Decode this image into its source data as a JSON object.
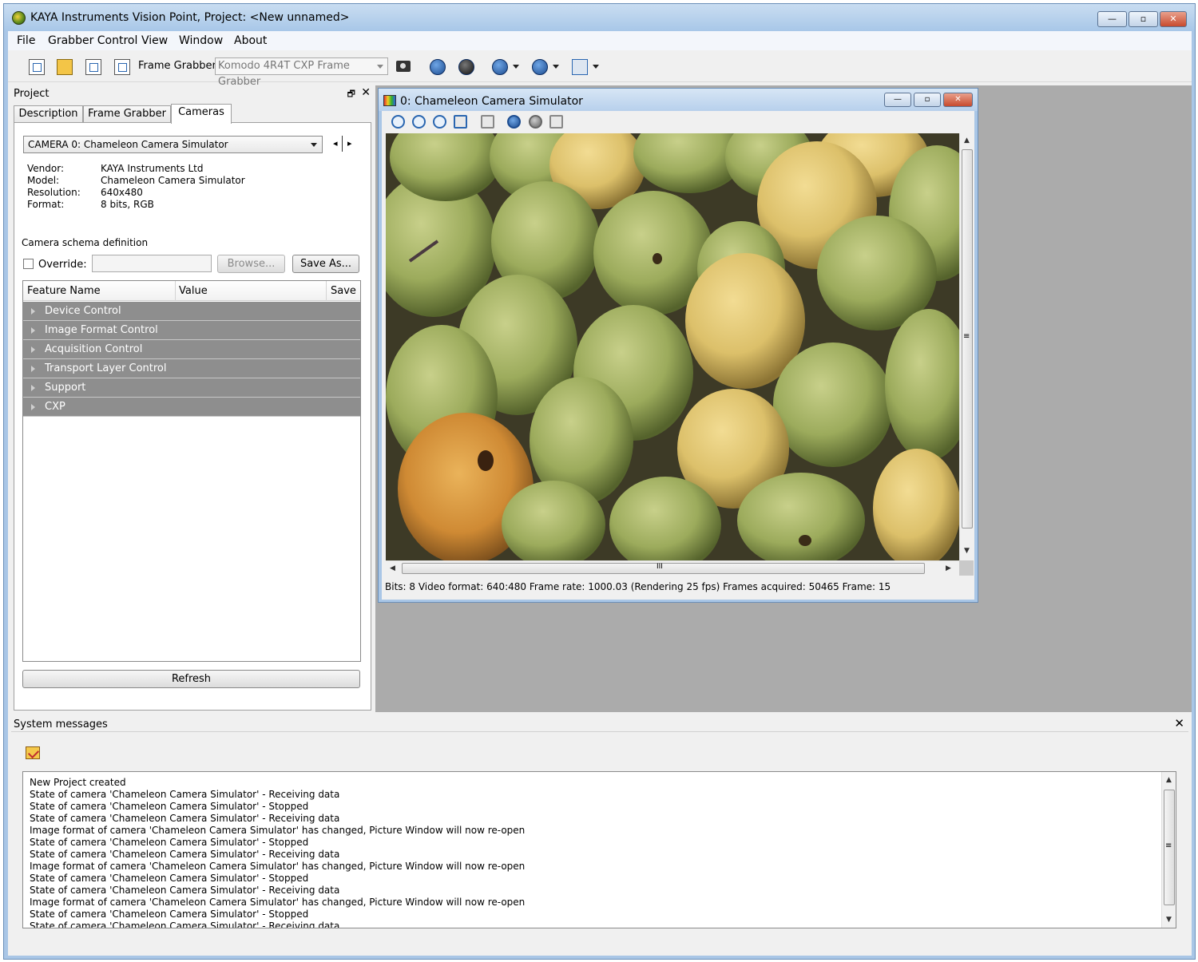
{
  "window": {
    "title": "KAYA Instruments Vision Point, Project: <New unnamed>",
    "min_label": "—",
    "max_label": "▫",
    "close_label": "✕"
  },
  "menu": [
    "File",
    "Grabber Control",
    "View",
    "Window",
    "About"
  ],
  "toolbar": {
    "frame_grabber_label": "Frame Grabber:",
    "frame_grabber_value": "Komodo 4R4T CXP Frame Grabber"
  },
  "project": {
    "title": "Project",
    "float_label": "🗗",
    "close_label": "✕",
    "tabs": [
      "Description",
      "Frame Grabber",
      "Cameras"
    ],
    "active_tab": "Cameras",
    "camera_select": "CAMERA 0: Chameleon Camera Simulator",
    "nav_prev": "◂",
    "nav_next": "▸",
    "info": [
      {
        "key": "Vendor:",
        "value": "KAYA Instruments Ltd"
      },
      {
        "key": "Model:",
        "value": "Chameleon Camera Simulator"
      },
      {
        "key": "Resolution:",
        "value": "640x480"
      },
      {
        "key": "Format:",
        "value": "8 bits, RGB"
      }
    ],
    "schema_label": "Camera schema definition",
    "override_label": "Override:",
    "override_checked": false,
    "override_value": "",
    "browse_label": "Browse...",
    "save_as_label": "Save As...",
    "feature_headers": [
      "Feature Name",
      "Value",
      "Save"
    ],
    "feature_categories": [
      "Device Control",
      "Image Format Control",
      "Acquisition Control",
      "Transport Layer Control",
      "Support",
      "CXP"
    ],
    "refresh_label": "Refresh"
  },
  "picture_window": {
    "title": "0: Chameleon Camera Simulator",
    "min_label": "—",
    "max_label": "▫",
    "close_label": "✕",
    "hscroll_grip": "III",
    "vscroll_grip": "≡",
    "status": "Bits: 8  Video format: 640:480  Frame rate: 1000.03 (Rendering 25 fps)  Frames acquired: 50465  Frame: 15"
  },
  "system_messages": {
    "title": "System messages",
    "close_label": "✕",
    "lines": [
      "New Project created",
      "State of camera 'Chameleon Camera Simulator' - Receiving data",
      "State of camera 'Chameleon Camera Simulator' - Stopped",
      "State of camera 'Chameleon Camera Simulator' - Receiving data",
      "Image format of camera 'Chameleon Camera Simulator' has changed, Picture Window will now re-open",
      "State of camera 'Chameleon Camera Simulator' - Stopped",
      "State of camera 'Chameleon Camera Simulator' - Receiving data",
      "Image format of camera 'Chameleon Camera Simulator' has changed, Picture Window will now re-open",
      "State of camera 'Chameleon Camera Simulator' - Stopped",
      "State of camera 'Chameleon Camera Simulator' - Receiving data",
      "Image format of camera 'Chameleon Camera Simulator' has changed, Picture Window will now re-open",
      "State of camera 'Chameleon Camera Simulator' - Stopped",
      "State of camera 'Chameleon Camera Simulator' - Receiving data"
    ],
    "vscroll_grip": "≡"
  },
  "colors": {
    "category_bg": "#8e8e8e",
    "window_frame": "#a9c6e6",
    "mdi_bg": "#ababab"
  }
}
